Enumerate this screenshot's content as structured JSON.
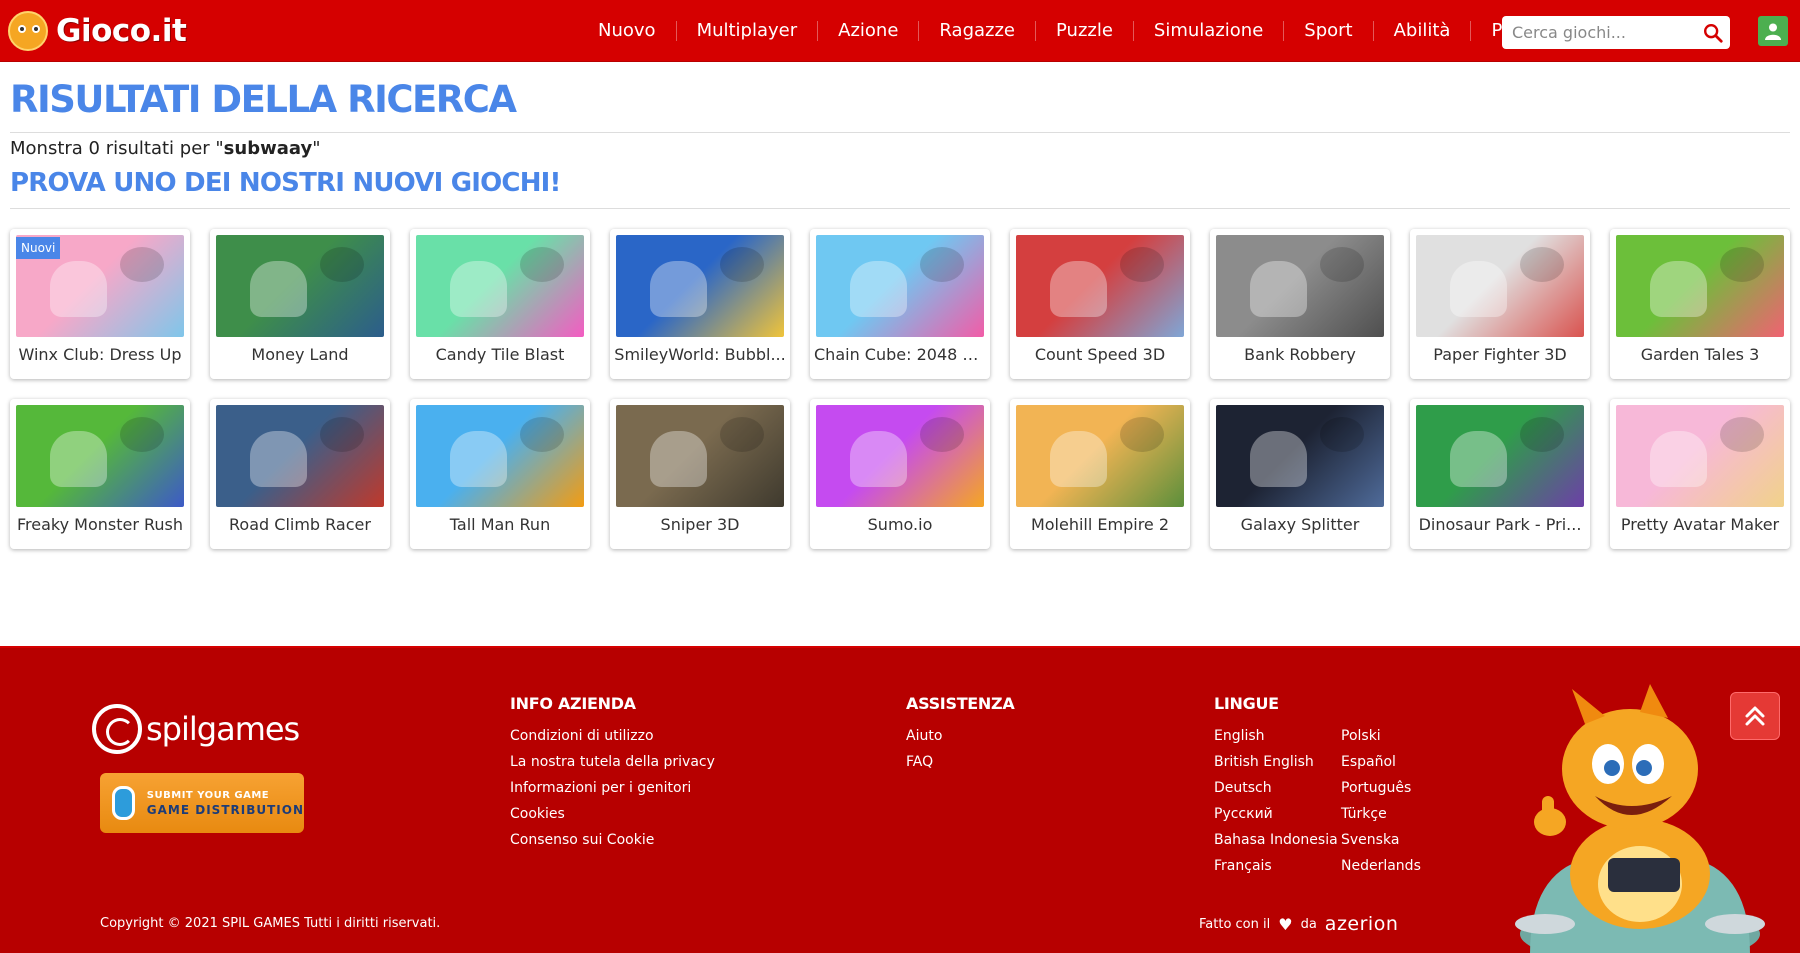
{
  "header": {
    "logo_text": "Gioco.it",
    "nav": [
      "Nuovo",
      "Multiplayer",
      "Azione",
      "Ragazze",
      "Puzzle",
      "Simulazione",
      "Sport",
      "Abilità",
      "Per te"
    ],
    "search_placeholder": "Cerca giochi..."
  },
  "main": {
    "title": "RISULTATI DELLA RICERCA",
    "result_prefix": "Monstra 0 risultati per \"",
    "query": "subwaay",
    "result_suffix": "\"",
    "subtitle": "PROVA UNO DEI NOSTRI NUOVI GIOCHI!",
    "badge_new": "Nuovi",
    "games": [
      {
        "name": "Winx Club: Dress Up",
        "new": true,
        "color1": "#f7a8c8",
        "color2": "#7fc6ea"
      },
      {
        "name": "Money Land",
        "color1": "#3e8e4a",
        "color2": "#2c5d8c"
      },
      {
        "name": "Candy Tile Blast",
        "color1": "#69e0a8",
        "color2": "#f45cc2"
      },
      {
        "name": "SmileyWorld: Bubbl...",
        "color1": "#2a66c7",
        "color2": "#f0c43a"
      },
      {
        "name": "Chain Cube: 2048 M...",
        "color1": "#6fc8f2",
        "color2": "#f25ca7"
      },
      {
        "name": "Count Speed 3D",
        "color1": "#d43f3f",
        "color2": "#7fa6d6"
      },
      {
        "name": "Bank Robbery",
        "color1": "#8c8c8c",
        "color2": "#4f4f4f"
      },
      {
        "name": "Paper Fighter 3D",
        "color1": "#e0e0e0",
        "color2": "#d9534f"
      },
      {
        "name": "Garden Tales 3",
        "color1": "#6cbf3a",
        "color2": "#f06272"
      },
      {
        "name": "Freaky Monster Rush",
        "color1": "#55b83a",
        "color2": "#3d5ac7"
      },
      {
        "name": "Road Climb Racer",
        "color1": "#3b5f8a",
        "color2": "#c0392b"
      },
      {
        "name": "Tall Man Run",
        "color1": "#4ab0ef",
        "color2": "#f39c12"
      },
      {
        "name": "Sniper 3D",
        "color1": "#7a6a4f",
        "color2": "#3f3a2e"
      },
      {
        "name": "Sumo.io",
        "color1": "#c54bf0",
        "color2": "#f5a623"
      },
      {
        "name": "Molehill Empire 2",
        "color1": "#f2b454",
        "color2": "#5c8f3b"
      },
      {
        "name": "Galaxy Splitter",
        "color1": "#1d2333",
        "color2": "#4f6b9a"
      },
      {
        "name": "Dinosaur Park - Pri...",
        "color1": "#2f9d4a",
        "color2": "#6d3fa8"
      },
      {
        "name": "Pretty Avatar Maker",
        "color1": "#f7b8d8",
        "color2": "#f1d28a"
      }
    ]
  },
  "footer": {
    "spil_text": "spilgames",
    "gd_line1": "SUBMIT YOUR GAME",
    "gd_line2": "GAME DISTRIBUTION",
    "info_title": "INFO AZIENDA",
    "info_links": [
      "Condizioni di utilizzo",
      "La nostra tutela della privacy",
      "Informazioni per i genitori",
      "Cookies",
      "Consenso sui Cookie"
    ],
    "help_title": "ASSISTENZA",
    "help_links": [
      "Aiuto",
      "FAQ"
    ],
    "lang_title": "LINGUE",
    "languages": [
      "English",
      "Polski",
      "British English",
      "Español",
      "Deutsch",
      "Português",
      "Русский",
      "Türkçe",
      "Bahasa Indonesia",
      "Svenska",
      "Français",
      "Nederlands"
    ],
    "copyright": "Copyright © 2021 SPIL GAMES Tutti i diritti riservati.",
    "made_with": "Fatto con il",
    "made_by": "da",
    "azerion": "azerion"
  },
  "colors": {
    "header_red": "#d50000",
    "footer_red": "#b70000",
    "title_blue": "#4a86e8",
    "user_green": "#4caf50"
  },
  "icons": [
    "search-icon",
    "user-icon",
    "heart-icon",
    "chevron-up-icon"
  ]
}
